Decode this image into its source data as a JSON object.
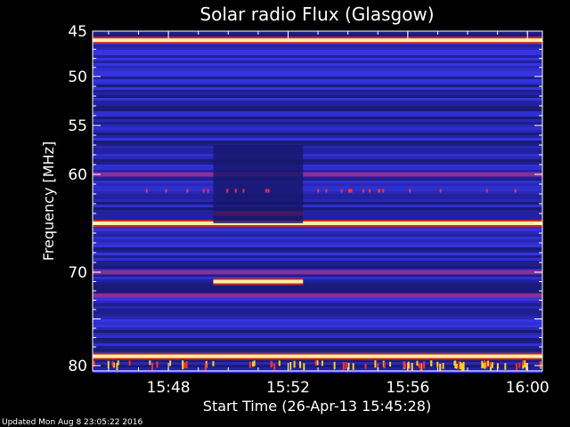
{
  "chart_data": {
    "type": "heatmap",
    "title": "Solar radio Flux (Glasgow)",
    "ylabel": "Frequency [MHz]",
    "xlabel": "Start Time (26-Apr-13 15:45:28)",
    "ylim": [
      45,
      80
    ],
    "y_axis_inverted": true,
    "y_scale": "nonlinear (as printed)",
    "y_ticks": [
      "45",
      "50",
      "55",
      "60",
      "65",
      "70",
      "75",
      "80"
    ],
    "y_ticks_visible": [
      "45",
      "50",
      "55",
      "60",
      "70",
      "80"
    ],
    "xlim": [
      "15:45:28",
      "16:00:30"
    ],
    "x_ticks": [
      "15:48",
      "15:52",
      "15:56",
      "16:00"
    ],
    "grid": false,
    "colormap": [
      "#000000",
      "#1a1a7a",
      "#2a2aee",
      "#8a2f9a",
      "#c2282e",
      "#ff2020",
      "#ffe020",
      "#ffffe0"
    ],
    "background_level_color": "#2a2acc",
    "interference_band_color": "#8a2f9a",
    "strong_line_color": "#ffe0a0",
    "features": [
      {
        "name": "strong constant line",
        "freq": 46.0,
        "start": "15:45:28",
        "end": "16:00:30",
        "level": "saturated"
      },
      {
        "name": "strong constant line",
        "freq": 65.0,
        "start": "15:45:28",
        "end": "16:00:30",
        "level": "saturated"
      },
      {
        "name": "strong constant line",
        "freq": 79.0,
        "start": "15:45:28",
        "end": "16:00:30",
        "level": "saturated"
      },
      {
        "name": "interference band",
        "freq": 60.0,
        "start": "15:45:28",
        "end": "16:00:30",
        "level": "moderate"
      },
      {
        "name": "interference band",
        "freq": 70.0,
        "start": "15:45:28",
        "end": "16:00:30",
        "level": "moderate"
      },
      {
        "name": "interference band",
        "freq": 72.5,
        "start": "15:45:28",
        "end": "16:00:30",
        "level": "moderate"
      },
      {
        "name": "transient carrier",
        "freq": 64.0,
        "start": "15:49:30",
        "end": "15:52:30",
        "level": "high"
      },
      {
        "name": "transient carrier",
        "freq": 71.0,
        "start": "15:49:30",
        "end": "15:52:30",
        "level": "saturated"
      },
      {
        "name": "attenuated interval",
        "freq_range": [
          57,
          65
        ],
        "start": "15:49:30",
        "end": "15:52:30",
        "level": "low"
      }
    ]
  },
  "footer": {
    "updated": "Updated Mon Aug  8 23:05:22 2016"
  }
}
